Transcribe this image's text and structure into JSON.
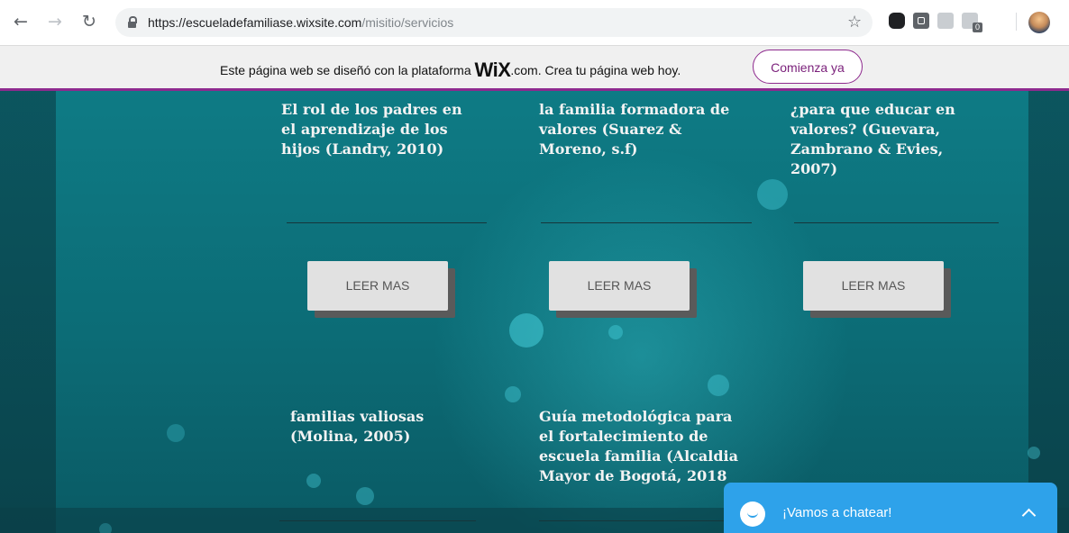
{
  "browser": {
    "url_host": "https://escueladefamiliase.wixsite.com",
    "url_path": "/misitio/servicios",
    "extension_badge": "0"
  },
  "wix_banner": {
    "text_before": "Este página web se diseñó con la plataforma ",
    "logo": "WiX",
    "text_after": ".com. Crea tu página web hoy.",
    "button_label": "Comienza ya"
  },
  "cards_row1": [
    {
      "title_lines": [
        "El rol de los padres en",
        "el aprendizaje de los",
        "hijos (Landry, 2010)"
      ],
      "button_label": "LEER MAS"
    },
    {
      "title_lines": [
        "la familia formadora de",
        "valores (Suarez &",
        "Moreno, s.f)"
      ],
      "button_label": "LEER MAS"
    },
    {
      "title_lines": [
        "¿para que educar en",
        "valores? (Guevara,",
        "Zambrano & Evies,",
        "2007)"
      ],
      "button_label": "LEER MAS"
    }
  ],
  "cards_row2": [
    {
      "title_lines": [
        "familias valiosas",
        "(Molina, 2005)"
      ]
    },
    {
      "title_lines": [
        "Guía metodológica para",
        "el fortalecimiento de",
        "escuela familia (Alcaldia",
        "Mayor de Bogotá, 2018"
      ]
    }
  ],
  "chat": {
    "label": "¡Vamos a chatear!"
  }
}
